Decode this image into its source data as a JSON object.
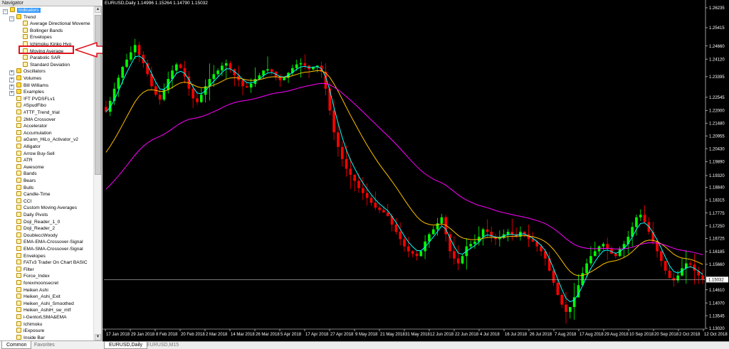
{
  "navigator": {
    "title": "Navigator",
    "tree": [
      {
        "label": "Indicators",
        "level": 0,
        "expander": "−",
        "selected": true,
        "icon": "folder-icon"
      },
      {
        "label": "Trend",
        "level": 1,
        "expander": "−",
        "icon": "folder-icon"
      },
      {
        "label": "Average Directional Moveme",
        "level": 2,
        "icon": "indicator-icon"
      },
      {
        "label": "Bollinger Bands",
        "level": 2,
        "icon": "indicator-icon"
      },
      {
        "label": "Envelopes",
        "level": 2,
        "icon": "indicator-icon"
      },
      {
        "label": "Ichimoku Kinko Hyo",
        "level": 2,
        "icon": "indicator-icon"
      },
      {
        "label": "Moving Average",
        "level": 2,
        "icon": "indicator-icon"
      },
      {
        "label": "Parabolic SAR",
        "level": 2,
        "icon": "indicator-icon"
      },
      {
        "label": "Standard Deviation",
        "level": 2,
        "icon": "indicator-icon"
      },
      {
        "label": "Oscillators",
        "level": 1,
        "expander": "+",
        "icon": "folder-icon"
      },
      {
        "label": "Volumes",
        "level": 1,
        "expander": "+",
        "icon": "folder-icon"
      },
      {
        "label": "Bill Williams",
        "level": 1,
        "expander": "+",
        "icon": "folder-icon"
      },
      {
        "label": "Examples",
        "level": 1,
        "expander": "+",
        "icon": "folder-icon"
      },
      {
        "label": "!FT PVDSFLv1",
        "level": 1,
        "icon": "indicator-icon"
      },
      {
        "label": "#SpudFibo",
        "level": 1,
        "icon": "indicator-icon"
      },
      {
        "label": "#TTF_Trend_trial",
        "level": 1,
        "icon": "indicator-icon"
      },
      {
        "label": "2MA Crossover",
        "level": 1,
        "icon": "indicator-icon"
      },
      {
        "label": "Accelerator",
        "level": 1,
        "icon": "indicator-icon"
      },
      {
        "label": "Accumulation",
        "level": 1,
        "icon": "indicator-icon"
      },
      {
        "label": "aGann_HiLo_Activator_v2",
        "level": 1,
        "icon": "indicator-icon"
      },
      {
        "label": "Alligator",
        "level": 1,
        "icon": "indicator-icon"
      },
      {
        "label": "Arrow Buy-Sell",
        "level": 1,
        "icon": "indicator-icon"
      },
      {
        "label": "ATR",
        "level": 1,
        "icon": "indicator-icon"
      },
      {
        "label": "Awesome",
        "level": 1,
        "icon": "indicator-icon"
      },
      {
        "label": "Bands",
        "level": 1,
        "icon": "indicator-icon"
      },
      {
        "label": "Bears",
        "level": 1,
        "icon": "indicator-icon"
      },
      {
        "label": "Bulls",
        "level": 1,
        "icon": "indicator-icon"
      },
      {
        "label": "Candle-Time",
        "level": 1,
        "icon": "indicator-icon"
      },
      {
        "label": "CCI",
        "level": 1,
        "icon": "indicator-icon"
      },
      {
        "label": "Custom Moving Averages",
        "level": 1,
        "icon": "indicator-icon"
      },
      {
        "label": "Daily Pivots",
        "level": 1,
        "icon": "indicator-icon"
      },
      {
        "label": "Doji_Reader_1_0",
        "level": 1,
        "icon": "indicator-icon"
      },
      {
        "label": "Doji_Reader_2",
        "level": 1,
        "icon": "indicator-icon"
      },
      {
        "label": "DoubleccWoody",
        "level": 1,
        "icon": "indicator-icon"
      },
      {
        "label": "EMA-EMA-Crossover-Signal",
        "level": 1,
        "icon": "indicator-icon"
      },
      {
        "label": "EMA-SMA-Crossover-Signal",
        "level": 1,
        "icon": "indicator-icon"
      },
      {
        "label": "Envelopes",
        "level": 1,
        "icon": "indicator-icon"
      },
      {
        "label": "FATv3 Trader On Chart BASIC",
        "level": 1,
        "icon": "indicator-icon"
      },
      {
        "label": "Filter",
        "level": 1,
        "icon": "indicator-icon"
      },
      {
        "label": "Force_Index",
        "level": 1,
        "icon": "indicator-icon"
      },
      {
        "label": "forexmoonsecret",
        "level": 1,
        "icon": "indicator-icon"
      },
      {
        "label": "Heiken Ashi",
        "level": 1,
        "icon": "indicator-icon"
      },
      {
        "label": "Heiken_Ashi_Exit",
        "level": 1,
        "icon": "indicator-icon"
      },
      {
        "label": "Heiken_Ashi_Smoothed",
        "level": 1,
        "icon": "indicator-icon"
      },
      {
        "label": "Heiken_AshiH_sw_mtf",
        "level": 1,
        "icon": "indicator-icon"
      },
      {
        "label": "i-GentorLSMA&EMA",
        "level": 1,
        "icon": "indicator-icon"
      },
      {
        "label": "Ichimoku",
        "level": 1,
        "icon": "indicator-icon"
      },
      {
        "label": "iExposure",
        "level": 1,
        "icon": "indicator-icon"
      },
      {
        "label": "Inside Bar",
        "level": 1,
        "icon": "indicator-icon"
      }
    ],
    "tabs": [
      "Common",
      "Favorites"
    ]
  },
  "chart": {
    "info": "EURUSD,Daily  1.14996 1.15264 1.14790 1.15032",
    "current_price": "1.15032",
    "tabs": [
      "EURUSD,Daily",
      "EURUSD,M15"
    ],
    "colors": {
      "bull": "#00ff00",
      "bear": "#ff0000",
      "ma_fast": "#00ffff",
      "ma_mid": "#ffc000",
      "ma_slow": "#ff00ff",
      "price_line": "#c0c0c0"
    }
  },
  "chart_data": {
    "type": "candlestick",
    "ylim": [
      1.1302,
      1.2638
    ],
    "y_ticks": [
      "1.26235",
      "1.25415",
      "1.24660",
      "1.24120",
      "1.23395",
      "1.22545",
      "1.22000",
      "1.21480",
      "1.20955",
      "1.20430",
      "1.19890",
      "1.19320",
      "1.18840",
      "1.18315",
      "1.17775",
      "1.17250",
      "1.16725",
      "1.16185",
      "1.15660",
      "1.15032",
      "1.14610",
      "1.14070",
      "1.13545",
      "1.13020"
    ],
    "x_ticks": [
      "17 Jan 2018",
      "29 Jan 2018",
      "8 Feb 2018",
      "20 Feb 2018",
      "2 Mar 2018",
      "14 Mar 2018",
      "26 Mar 2018",
      "5 Apr 2018",
      "17 Apr 2018",
      "27 Apr 2018",
      "9 May 2018",
      "21 May 2018",
      "31 May 2018",
      "12 Jun 2018",
      "22 Jun 2018",
      "4 Jul 2018",
      "16 Jul 2018",
      "26 Jul 2018",
      "7 Aug 2018",
      "17 Aug 2018",
      "29 Aug 2018",
      "10 Sep 2018",
      "20 Sep 2018",
      "2 Oct 2018",
      "12 Oct 2018"
    ],
    "closes": [
      1.2195,
      1.224,
      1.229,
      1.2335,
      1.238,
      1.241,
      1.244,
      1.247,
      1.243,
      1.2395,
      1.235,
      1.23,
      1.2265,
      1.2245,
      1.2285,
      1.233,
      1.2365,
      1.239,
      1.2375,
      1.234,
      1.229,
      1.225,
      1.2235,
      1.2265,
      1.23,
      1.233,
      1.235,
      1.2365,
      1.2385,
      1.2395,
      1.237,
      1.2345,
      1.2325,
      1.23,
      1.2295,
      1.231,
      1.233,
      1.2345,
      1.2365,
      1.237,
      1.236,
      1.234,
      1.2325,
      1.2335,
      1.2355,
      1.2375,
      1.239,
      1.2395,
      1.2385,
      1.237,
      1.238,
      1.2385,
      1.236,
      1.229,
      1.22,
      1.211,
      1.205,
      1.2,
      1.196,
      1.1935,
      1.191,
      1.188,
      1.186,
      1.184,
      1.182,
      1.18,
      1.179,
      1.178,
      1.1765,
      1.173,
      1.17,
      1.167,
      1.164,
      1.162,
      1.161,
      1.16,
      1.162,
      1.166,
      1.169,
      1.171,
      1.1735,
      1.176,
      1.169,
      1.162,
      1.159,
      1.157,
      1.16,
      1.164,
      1.165,
      1.166,
      1.168,
      1.171,
      1.17,
      1.168,
      1.167,
      1.1675,
      1.169,
      1.17,
      1.169,
      1.168,
      1.17,
      1.169,
      1.167,
      1.166,
      1.164,
      1.162,
      1.159,
      1.154,
      1.149,
      1.144,
      1.14,
      1.137,
      1.139,
      1.143,
      1.148,
      1.153,
      1.157,
      1.16,
      1.162,
      1.164,
      1.165,
      1.163,
      1.161,
      1.16,
      1.163,
      1.165,
      1.168,
      1.172,
      1.176,
      1.177,
      1.174,
      1.17,
      1.166,
      1.162,
      1.158,
      1.154,
      1.151,
      1.15,
      1.152,
      1.155,
      1.157,
      1.1565,
      1.154,
      1.152,
      1.1503
    ]
  }
}
